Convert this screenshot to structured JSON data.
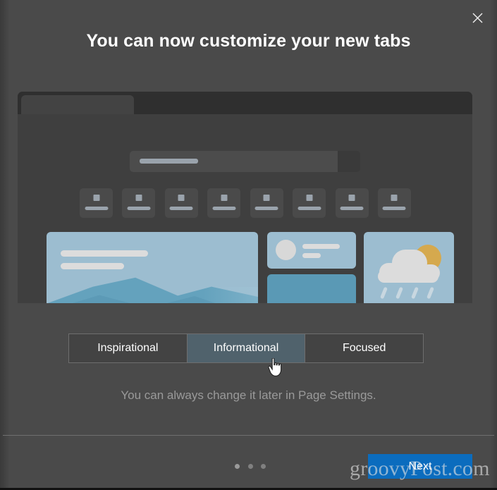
{
  "dialog": {
    "title": "You can now customize your new tabs",
    "helper_text": "You can always change it later in Page Settings.",
    "close_label": "Close",
    "background_color": "#4a4a4a"
  },
  "preview": {
    "window_background": "#3f3f3f",
    "tabstrip_background": "#2f2f2f",
    "search": {
      "name": "search-box",
      "placeholder_visible": true
    },
    "quick_links_count": 8,
    "cards": {
      "hero": {
        "name": "hero-image-card",
        "sky_color": "#9cbdd0",
        "mountain_color": "#5a99b5"
      },
      "profile": {
        "name": "profile-card",
        "background": "#9cbdd0"
      },
      "solid": {
        "name": "content-card",
        "background": "#5a99b5"
      },
      "weather": {
        "name": "weather-card",
        "background": "#9cbdd0",
        "sun_color": "#d5a94e",
        "cloud_color": "#dcdcdc",
        "rain_color": "#c8d7e0",
        "rain_streaks": 4
      }
    }
  },
  "layout_options": {
    "selected": "Informational",
    "selected_color": "#50626c",
    "tabs": [
      {
        "label": "Inspirational",
        "selected": false
      },
      {
        "label": "Informational",
        "selected": true
      },
      {
        "label": "Focused",
        "selected": false
      }
    ]
  },
  "footer": {
    "next_label": "Next",
    "next_color": "#0b6cbe",
    "pagination": {
      "total": 3,
      "current": 1
    }
  },
  "watermark": {
    "text": "groovyPost.com"
  }
}
